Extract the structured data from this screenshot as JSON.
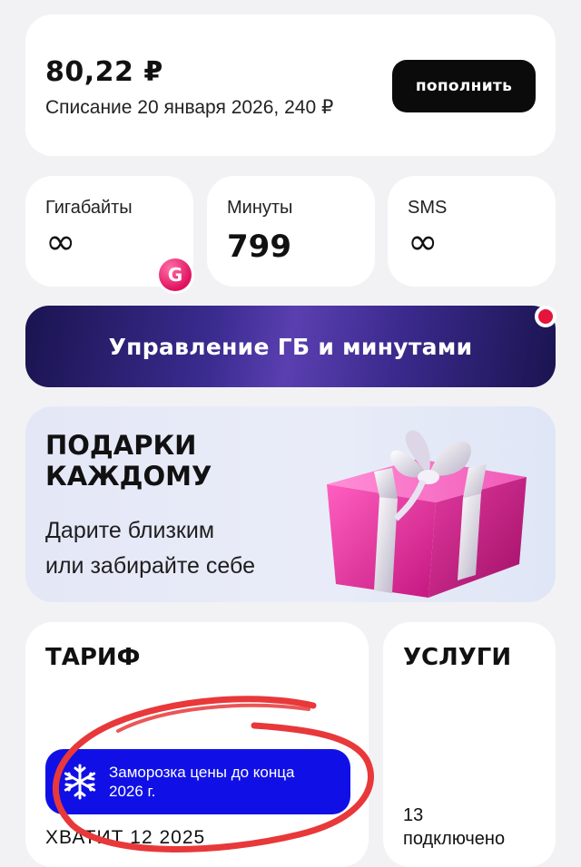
{
  "balance": {
    "amount": "80,22 ₽",
    "debit": "Списание 20 января 2026, 240 ₽",
    "topup_label": "пополнить"
  },
  "stats": [
    {
      "label": "Гигабайты",
      "value": "∞"
    },
    {
      "label": "Минуты",
      "value": "799"
    },
    {
      "label": "SMS",
      "value": "∞"
    }
  ],
  "badge": {
    "letter": "G",
    "color": "#e0115f"
  },
  "manage_banner": {
    "label": "Управление ГБ и минутами",
    "has_notification": true,
    "notification_color": "#e5143c"
  },
  "gifts": {
    "title": "ПОДАРКИ\nКАЖДОМУ",
    "subtitle": "Дарите близким\nили забирайте себе",
    "image_icon": "gift-box-icon"
  },
  "tariff": {
    "heading": "ТАРИФ",
    "freeze_text": "Заморозка цены до конца\n2026 г.",
    "freeze_icon": "snowflake-icon",
    "freeze_color": "#1010e6",
    "until_text": "ХВАТИТ 12 2025"
  },
  "services": {
    "heading": "УСЛУГИ",
    "count_text": "13\nподключено"
  },
  "annotation": {
    "shape": "hand-drawn-circle",
    "color": "#e8383a"
  }
}
